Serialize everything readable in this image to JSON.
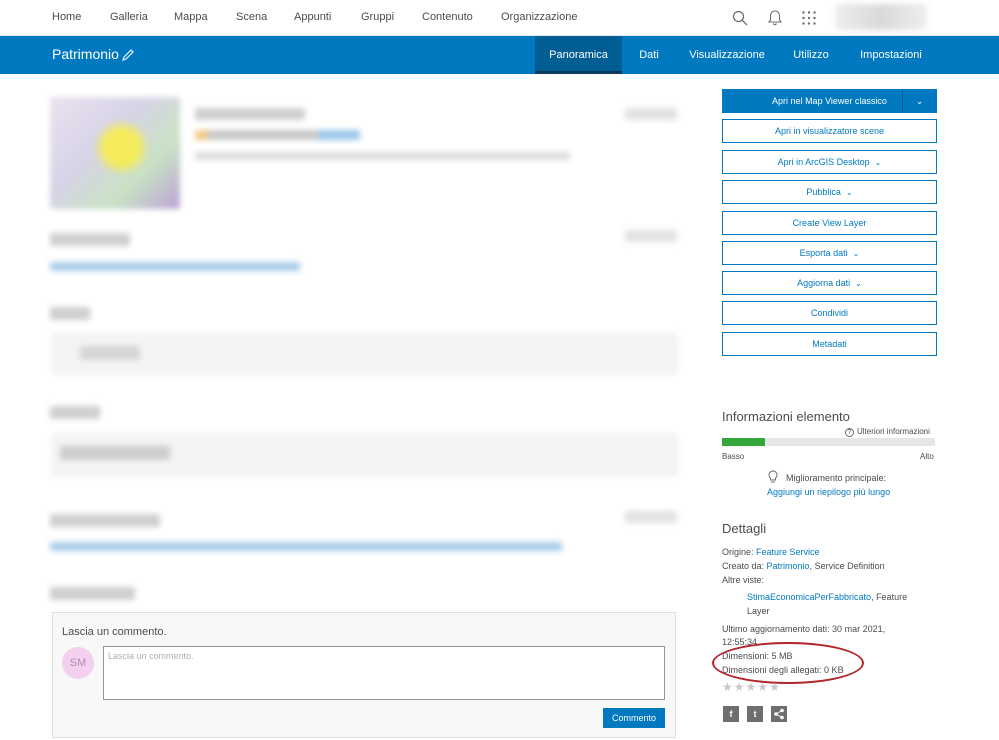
{
  "topnav": {
    "links": [
      "Home",
      "Galleria",
      "Mappa",
      "Scena",
      "Appunti",
      "Gruppi",
      "Contenuto",
      "Organizzazione"
    ]
  },
  "header": {
    "title": "Patrimonio",
    "tabs": [
      "Panoramica",
      "Dati",
      "Visualizzazione",
      "Utilizzo",
      "Impostazioni"
    ],
    "active_tab": "Panoramica"
  },
  "actions": {
    "open_map_viewer": "Apri nel Map Viewer classico",
    "open_scene_viewer": "Apri in visualizzatore scene",
    "open_arcgis_desktop": "Apri in ArcGIS Desktop",
    "publish": "Pubblica",
    "create_view_layer": "Create View Layer",
    "export_data": "Esporta dati",
    "update_data": "Aggiorna dati",
    "share": "Condividi",
    "metadata": "Metadati"
  },
  "item_info": {
    "title": "Informazioni elemento",
    "more_info": "Ulteriori informazioni",
    "low": "Basso",
    "high": "Alto",
    "score_fraction": 0.2,
    "improvement_label": "Miglioramento principale:",
    "improvement_link": "Aggiungi un riepilogo più lungo"
  },
  "details": {
    "title": "Dettagli",
    "origin_label": "Origine:",
    "origin_value": "Feature Service",
    "created_by_label": "Creato da:",
    "created_by_value": "Patrimonio",
    "created_by_suffix": ", Service Definition",
    "other_views_label": "Altre viste:",
    "other_view_link": "StimaEconomicaPerFabbricato",
    "other_view_type_a": ", Feature",
    "other_view_type_b": "Layer",
    "last_update_line1": "Ultimo aggiornamento dati: 30 mar 2021,",
    "last_update_line2": "12:55:34",
    "size": "Dimensioni: 5 MB",
    "attachments_size": "Dimensioni degli allegati: 0 KB"
  },
  "comments": {
    "prompt": "Lascia un commento.",
    "avatar_initials": "SM",
    "placeholder": "Lascia un commento.",
    "submit_label": "Commento"
  },
  "colors": {
    "brand_blue": "#0079c1",
    "active_tab": "#005e95",
    "meter_fill": "#35a63a",
    "highlight_oval": "#b0262b"
  }
}
